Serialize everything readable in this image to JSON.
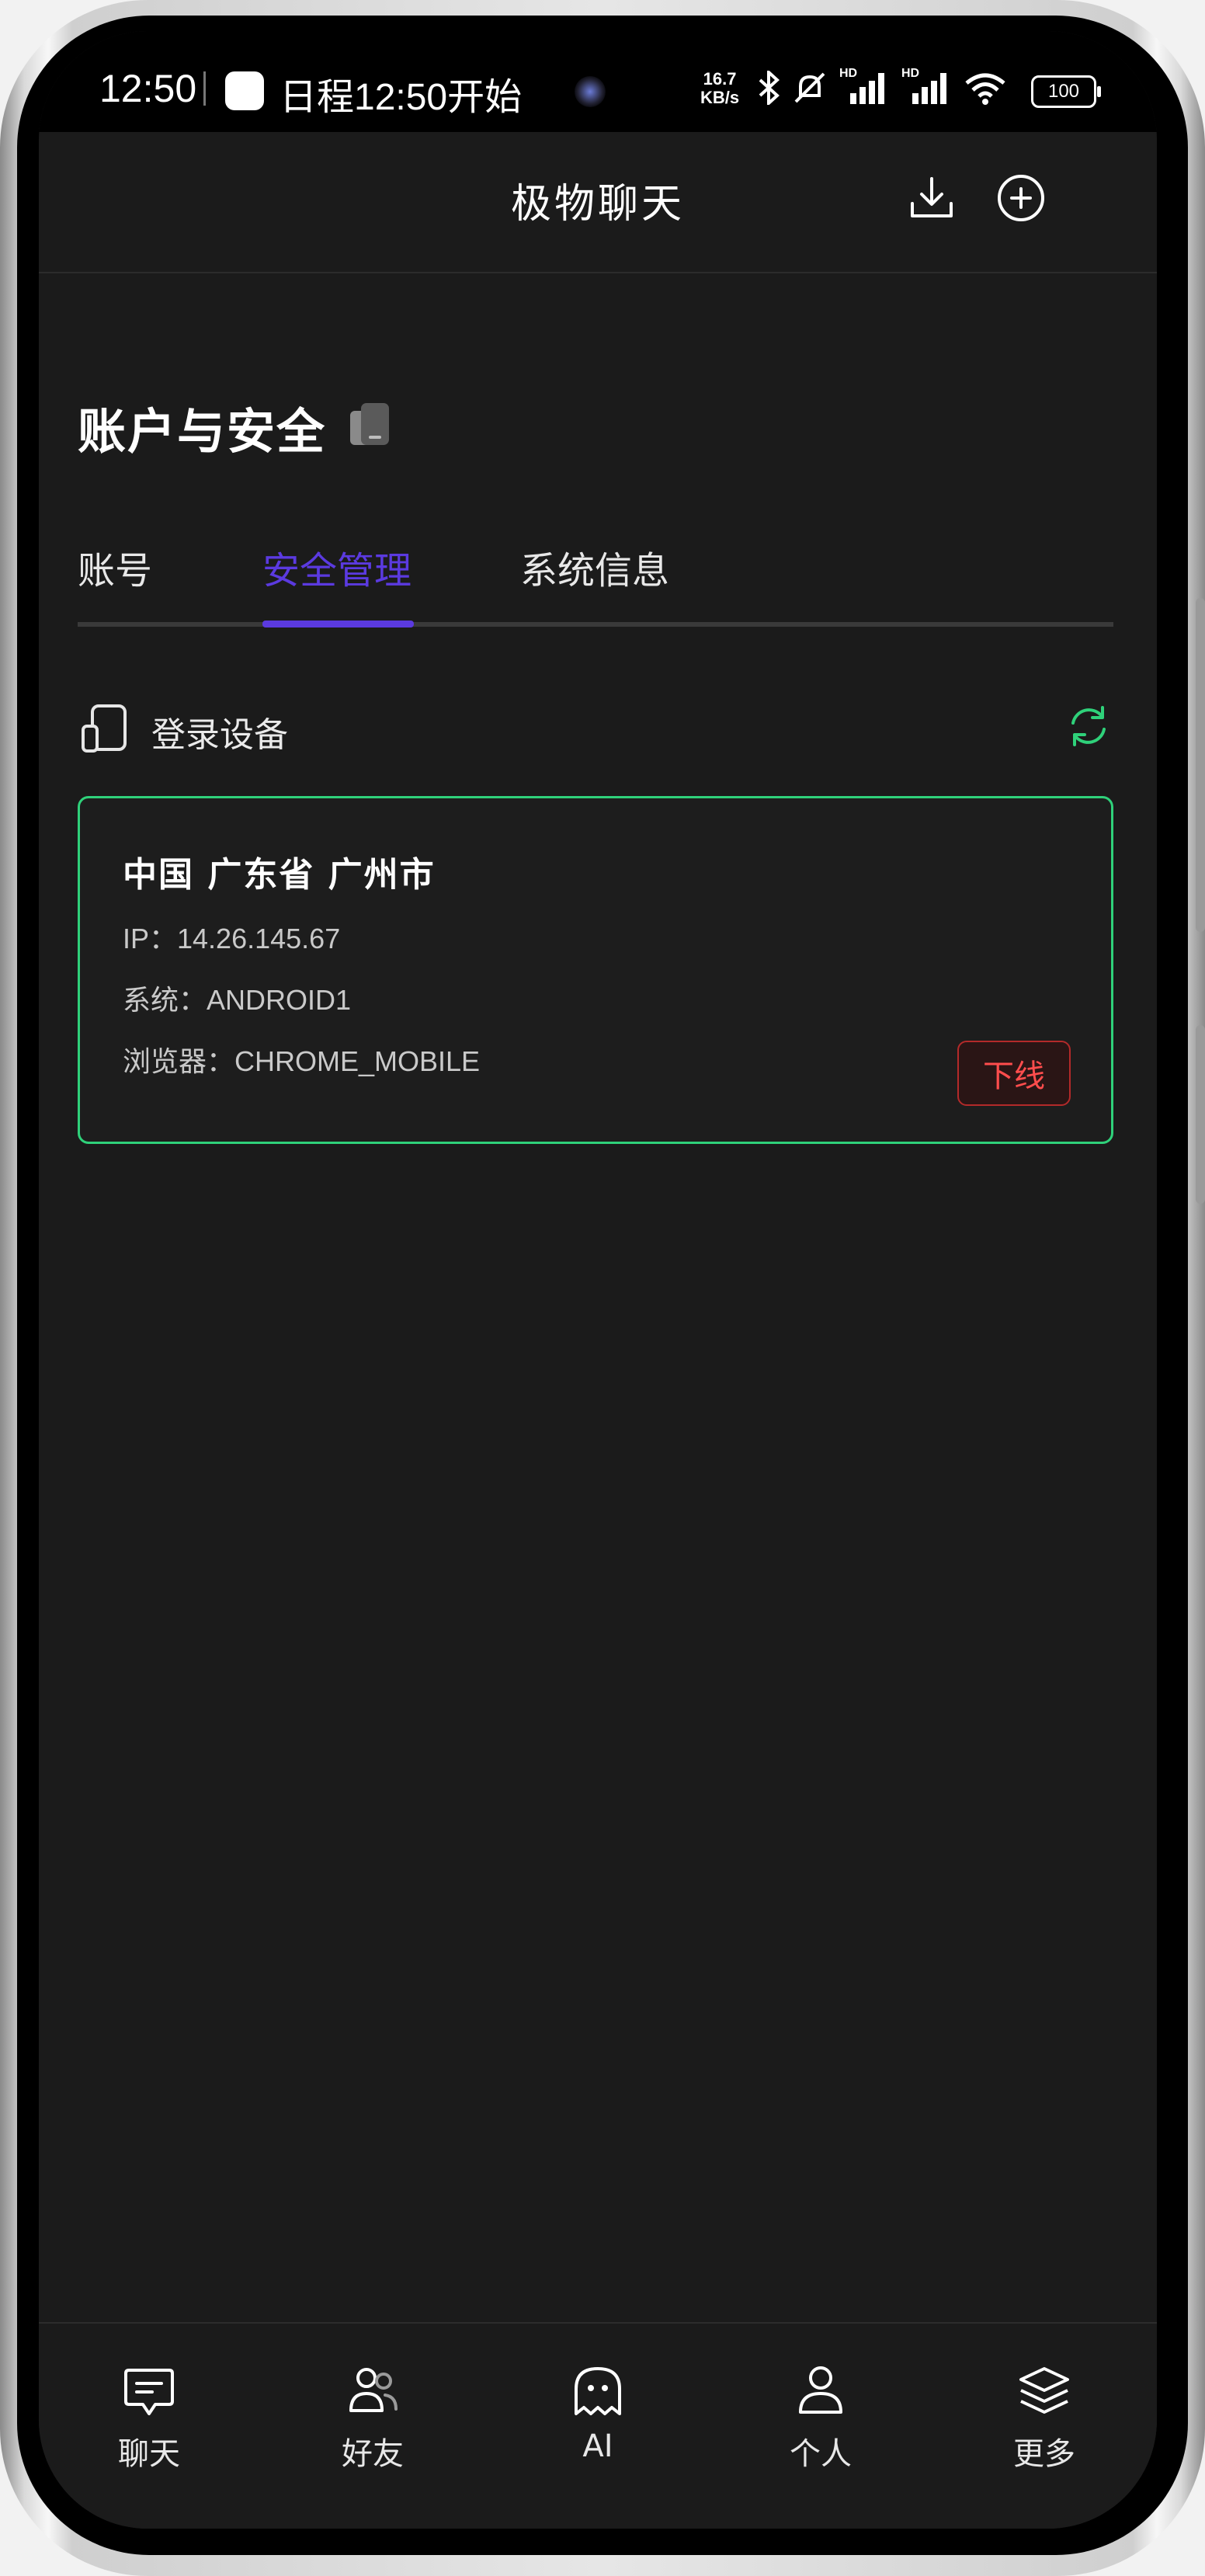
{
  "status_bar": {
    "time": "12:50",
    "notification": "日程12:50开始",
    "net_speed_value": "16.7",
    "net_speed_unit": "KB/s",
    "signal_tag_1": "HD",
    "signal_tag_2": "HD",
    "battery": "100"
  },
  "header": {
    "title": "极物聊天",
    "download_icon": "download-icon",
    "add_icon": "plus-circle-icon"
  },
  "page": {
    "title": "账户与安全",
    "title_icon": "phone-badge-icon"
  },
  "tabs": [
    {
      "label": "账号",
      "active": false
    },
    {
      "label": "安全管理",
      "active": true
    },
    {
      "label": "系统信息",
      "active": false
    }
  ],
  "section": {
    "title": "登录设备",
    "icon": "devices-icon",
    "refresh_icon": "refresh-icon"
  },
  "device": {
    "location": "中国 广东省 广州市",
    "ip": "IP：14.26.145.67",
    "system": "系统：ANDROID1",
    "browser": "浏览器：CHROME_MOBILE",
    "offline_label": "下线"
  },
  "bottom_nav": [
    {
      "label": "聊天",
      "icon": "chat-bubble-icon"
    },
    {
      "label": "好友",
      "icon": "friends-icon"
    },
    {
      "label": "AI",
      "icon": "ghost-icon"
    },
    {
      "label": "个人",
      "icon": "person-icon"
    },
    {
      "label": "更多",
      "icon": "layers-icon"
    }
  ],
  "colors": {
    "accent": "#5b3ae0",
    "success": "#2fd17a",
    "danger": "#ff4d4d",
    "background": "#1b1b1b"
  }
}
